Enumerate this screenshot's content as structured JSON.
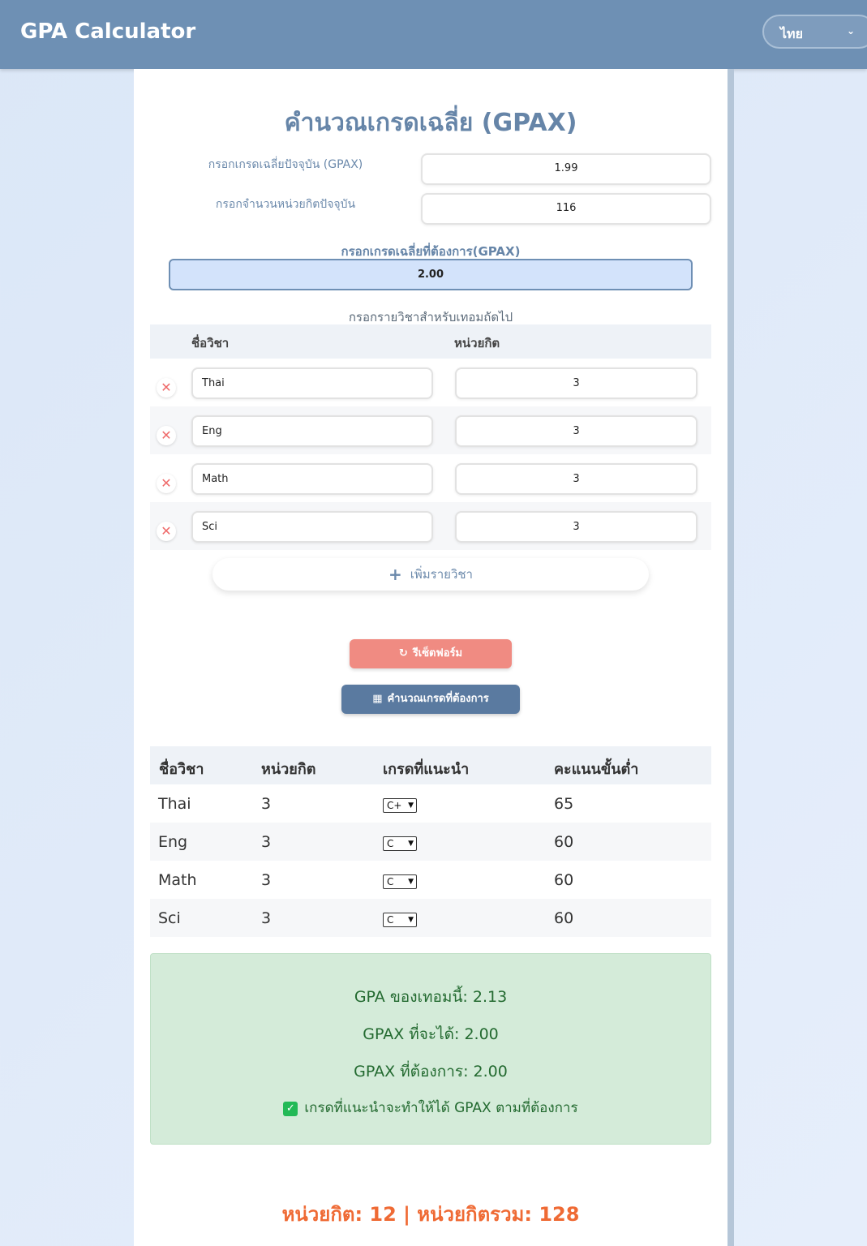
{
  "header": {
    "brand": "GPA Calculator",
    "language": "ไทย"
  },
  "form": {
    "title": "คำนวณเกรดเฉลี่ย (GPAX)",
    "current_gpax_label": "กรอกเกรดเฉลี่ยปัจจุบัน (GPAX)",
    "current_gpax_value": "1.99",
    "current_credits_label": "กรอกจำนวนหน่วยกิตปัจจุบัน",
    "current_credits_value": "116",
    "target_gpax_label": "กรอกเกรดเฉลี่ยที่ต้องการ(GPAX)",
    "target_gpax_value": "2.00",
    "next_term_label": "กรอกรายวิชาสำหรับเทอมถัดไป",
    "col_subject": "ชื่อวิชา",
    "col_credits": "หน่วยกิต",
    "courses": [
      {
        "name": "Thai",
        "credits": "3"
      },
      {
        "name": "Eng",
        "credits": "3"
      },
      {
        "name": "Math",
        "credits": "3"
      },
      {
        "name": "Sci",
        "credits": "3"
      }
    ],
    "add_course_label": "เพิ่มรายวิชา",
    "reset_label": "รีเซ็ตฟอร์ม",
    "calculate_label": "คำนวณเกรดที่ต้องการ"
  },
  "results": {
    "headers": [
      "ชื่อวิชา",
      "หน่วยกิต",
      "เกรดที่แนะนำ",
      "คะแนนขั้นต่ำ"
    ],
    "rows": [
      {
        "name": "Thai",
        "credits": "3",
        "grade": "C+",
        "min_score": "65"
      },
      {
        "name": "Eng",
        "credits": "3",
        "grade": "C",
        "min_score": "60"
      },
      {
        "name": "Math",
        "credits": "3",
        "grade": "C",
        "min_score": "60"
      },
      {
        "name": "Sci",
        "credits": "3",
        "grade": "C",
        "min_score": "60"
      }
    ]
  },
  "summary": {
    "term_gpa": "GPA ของเทอมนี้: 2.13",
    "projected_gpax": "GPAX ที่จะได้: 2.00",
    "target_gpax": "GPAX ที่ต้องการ: 2.00",
    "status": "เกรดที่แนะนำจะทำให้ได้ GPAX ตามที่ต้องการ"
  },
  "footer": {
    "credits_text": "หน่วยกิต: 12 | หน่วยกิตรวม: 128"
  },
  "colors": {
    "header": "#6e90b4",
    "accent": "#6685a8",
    "reset": "#f08b82",
    "calculate": "#5a7aa0",
    "success_bg": "#d4ebd9",
    "footer_text": "#ef6a34"
  }
}
